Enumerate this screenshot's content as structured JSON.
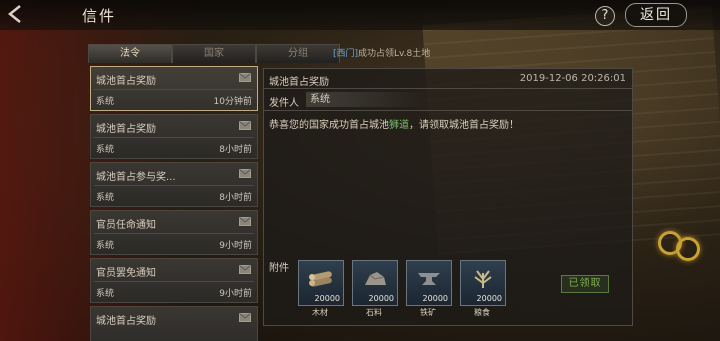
{
  "header": {
    "title": "信件",
    "help_label": "?",
    "return_label": "返回"
  },
  "tabs": [
    {
      "label": "法令",
      "active": true
    },
    {
      "label": "国家",
      "active": false
    },
    {
      "label": "分组",
      "active": false
    }
  ],
  "tab_overflow": {
    "tag": "[西门]",
    "text": "成功占领Lv.8土地"
  },
  "mail_list": [
    {
      "subject": "城池首占奖励",
      "sender": "系统",
      "time": "10分钟前",
      "selected": true
    },
    {
      "subject": "城池首占奖励",
      "sender": "系统",
      "time": "8小时前",
      "selected": false
    },
    {
      "subject": "城池首占参与奖...",
      "sender": "系统",
      "time": "8小时前",
      "selected": false
    },
    {
      "subject": "官员任命通知",
      "sender": "系统",
      "time": "9小时前",
      "selected": false
    },
    {
      "subject": "官员罢免通知",
      "sender": "系统",
      "time": "9小时前",
      "selected": false
    },
    {
      "subject": "城池首占奖励",
      "sender": "",
      "time": "",
      "selected": false
    }
  ],
  "detail": {
    "subject": "城池首占奖励",
    "date": "2019-12-06 20:26:01",
    "sender_label": "发件人",
    "sender_name": "系统",
    "body_prefix": "恭喜您的国家成功首占城池",
    "body_location": "狮道",
    "body_suffix": "，请领取城池首占奖励！",
    "attachment_label": "附件",
    "attachments": [
      {
        "name": "木材",
        "quantity": "20000",
        "icon": "wood-icon"
      },
      {
        "name": "石料",
        "quantity": "20000",
        "icon": "stone-icon"
      },
      {
        "name": "铁矿",
        "quantity": "20000",
        "icon": "iron-icon"
      },
      {
        "name": "粮食",
        "quantity": "20000",
        "icon": "grain-icon"
      }
    ],
    "claimed_label": "已领取"
  },
  "colors": {
    "location_highlight": "#79c06a",
    "claimed_green": "#7fb04f",
    "tab_tag_blue": "#6ba6d8"
  }
}
